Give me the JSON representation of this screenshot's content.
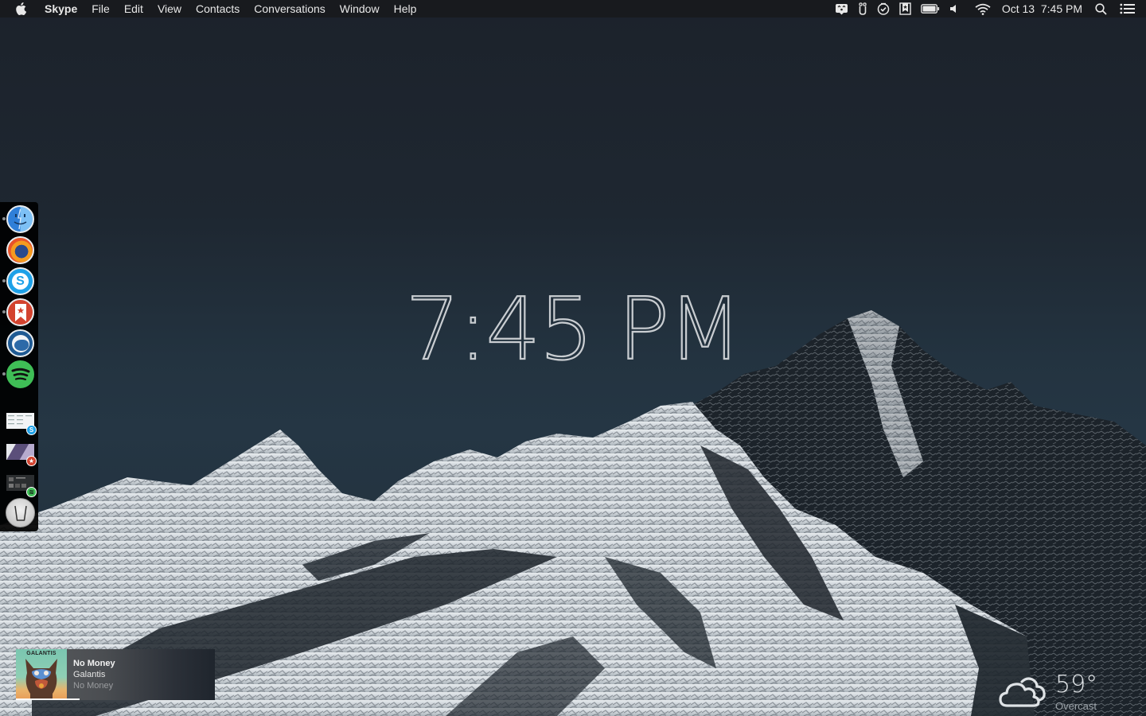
{
  "menubar": {
    "app_name": "Skype",
    "menus": [
      "File",
      "Edit",
      "View",
      "Contacts",
      "Conversations",
      "Window",
      "Help"
    ],
    "status_icons": [
      "notification-face-icon",
      "usb-device-icon",
      "task-check-icon",
      "bookmark-star-icon",
      "battery-icon",
      "volume-icon",
      "wifi-icon"
    ],
    "date": "Oct 13",
    "time": "7:45 PM"
  },
  "desktop": {
    "clock": "7:45 PM"
  },
  "dock": {
    "apps": [
      {
        "name": "Finder",
        "icon": "finder-icon",
        "running": true,
        "color": "#3a8fe0"
      },
      {
        "name": "Firefox",
        "icon": "firefox-icon",
        "running": false,
        "color": "#e8662a"
      },
      {
        "name": "Skype",
        "icon": "skype-icon",
        "running": true,
        "color": "#1da1e8"
      },
      {
        "name": "Wunderlist",
        "icon": "wunderlist-icon",
        "running": true,
        "color": "#d3432f"
      },
      {
        "name": "Thunderbird",
        "icon": "thunderbird-icon",
        "running": false,
        "color": "#1f5a93"
      },
      {
        "name": "Spotify",
        "icon": "spotify-icon",
        "running": true,
        "color": "#3fbe56"
      }
    ],
    "windows": [
      {
        "app": "Skype",
        "badge_icon": "skype-icon",
        "badge_color": "#1da1e8",
        "badge_glyph": "S"
      },
      {
        "app": "Wunderlist",
        "badge_icon": "wunderlist-icon",
        "badge_color": "#d3432f",
        "badge_glyph": "★"
      },
      {
        "app": "Spotify",
        "badge_icon": "spotify-icon",
        "badge_color": "#3fbe56",
        "badge_glyph": "≋"
      }
    ],
    "trash": "Trash"
  },
  "now_playing": {
    "title": "No Money",
    "artist": "Galantis",
    "album": "No Money",
    "album_art_text": "GALANTIS",
    "progress_percent": 32
  },
  "weather": {
    "temperature": "59°",
    "condition": "Overcast",
    "icon": "cloud-icon"
  }
}
